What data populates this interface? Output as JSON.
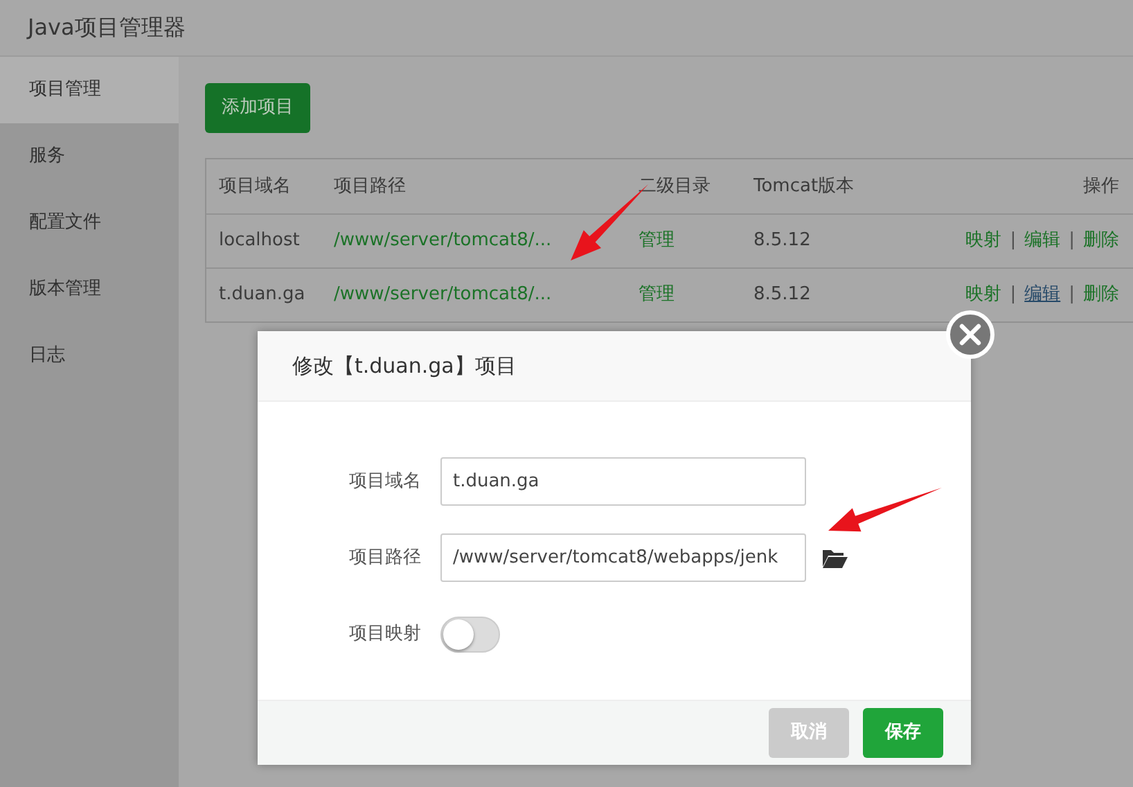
{
  "app": {
    "title": "Java项目管理器"
  },
  "sidebar": {
    "items": [
      {
        "label": "项目管理",
        "selected": true
      },
      {
        "label": "服务",
        "selected": false
      },
      {
        "label": "配置文件",
        "selected": false
      },
      {
        "label": "版本管理",
        "selected": false
      },
      {
        "label": "日志",
        "selected": false
      }
    ]
  },
  "add_button": "添加项目",
  "table": {
    "columns": [
      "项目域名",
      "项目路径",
      "二级目录",
      "Tomcat版本",
      "操作"
    ],
    "rows": [
      {
        "domain": "localhost",
        "path": "/www/server/tomcat8/...",
        "subdir": "管理",
        "version": "8.5.12",
        "actions": [
          {
            "label": "映射",
            "hovered": false
          },
          {
            "separator": "|",
            "label": "编辑",
            "hovered": false
          },
          {
            "separator": "|",
            "label": "删除",
            "hovered": false
          }
        ]
      },
      {
        "domain": "t.duan.ga",
        "path": "/www/server/tomcat8/...",
        "subdir": "管理",
        "version": "8.5.12",
        "actions": [
          {
            "label": "映射",
            "hovered": false
          },
          {
            "separator": "|",
            "label": "编辑",
            "hovered": true
          },
          {
            "separator": "|",
            "label": "删除",
            "hovered": false
          }
        ]
      }
    ]
  },
  "dialog": {
    "title": "修改【t.duan.ga】项目",
    "fields": [
      {
        "kind": "text",
        "label": "项目域名",
        "value": "t.duan.ga"
      },
      {
        "kind": "path",
        "label": "项目路径",
        "value": "/www/server/tomcat8/webapps/jenk"
      },
      {
        "kind": "toggle",
        "label": "项目映射",
        "on": false
      }
    ],
    "buttons": [
      {
        "kind": "cancel",
        "label": "取消"
      },
      {
        "kind": "primary",
        "label": "保存"
      }
    ]
  },
  "annotations": [
    {
      "kind": "arrow"
    },
    {
      "kind": "arrow"
    }
  ]
}
